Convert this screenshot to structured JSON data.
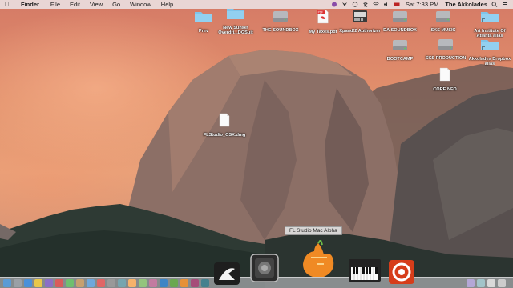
{
  "menubar": {
    "app_name": "Finder",
    "items": [
      "File",
      "Edit",
      "View",
      "Go",
      "Window",
      "Help"
    ],
    "clock": "Sat 7:33 PM",
    "user": "The Akkolades"
  },
  "desktop": {
    "icons": [
      {
        "label": "Prev",
        "kind": "folder"
      },
      {
        "label": "New Sunset Overdri...DGSuit",
        "kind": "folder"
      },
      {
        "label": "THE SOUNDBOX",
        "kind": "disk"
      },
      {
        "label": "My Taxes.pdf",
        "kind": "pdf"
      },
      {
        "label": "Xpand!2 Authorizer",
        "kind": "app"
      },
      {
        "label": "DA SOUNDBOX",
        "kind": "disk"
      },
      {
        "label": "SKS MUSIC",
        "kind": "disk"
      },
      {
        "label": "Art Institute Of Atlanta alias",
        "kind": "folder"
      },
      {
        "label": "BOOTCAMP",
        "kind": "disk"
      },
      {
        "label": "SKS PRODUCTION",
        "kind": "disk"
      },
      {
        "label": "Akkolades Dropbox alias",
        "kind": "folder"
      },
      {
        "label": "CORE.NFO",
        "kind": "document"
      },
      {
        "label": "FLStudio_OSX.dmg",
        "kind": "document"
      }
    ]
  },
  "tooltip": "FL Studio Mac Alpha",
  "colors": {
    "folder": "#7ec4ea",
    "disk": "#b7b9bd",
    "menubar": "#ece2e4",
    "accent_orange": "#e86f1c"
  },
  "dock": {
    "apps": [
      {
        "name": "Cubase",
        "icon": "cubase-icon"
      },
      {
        "name": "Logic Pro",
        "icon": "logic-icon"
      },
      {
        "name": "FL Studio",
        "icon": "fl-studio-icon"
      },
      {
        "name": "Keyboard",
        "icon": "piano-icon"
      },
      {
        "name": "Reason",
        "icon": "reason-icon"
      }
    ]
  }
}
